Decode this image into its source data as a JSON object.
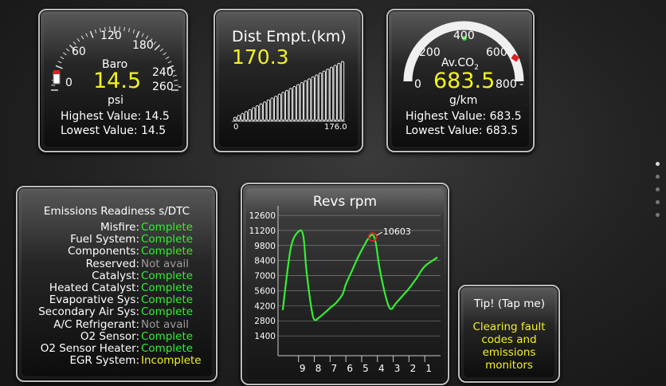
{
  "baro": {
    "title": "Baro",
    "value": "14.5",
    "unit": "psi",
    "ticks": [
      "0",
      "60",
      "120",
      "180",
      "240",
      "260"
    ],
    "highest": "Highest Value: 14.5",
    "lowest": "Lowest Value: 14.5"
  },
  "dist": {
    "title": "Dist Empt.(km)",
    "value": "170.3",
    "x_min": "0",
    "x_max": "176.0"
  },
  "co2": {
    "title": "Av.CO",
    "title_sub": "2",
    "value": "683.5",
    "unit": "g/km",
    "ticks": [
      "0",
      "200",
      "400",
      "600",
      "800"
    ],
    "highest": "Highest Value: 683.5",
    "lowest": "Lowest Value: 683.5",
    "colors": {
      "arc": "#f0f0f0",
      "marker": "#33dd33",
      "warn": "#e02020"
    }
  },
  "emissions": {
    "title": "Emissions Readiness s/DTC",
    "rows": [
      {
        "label": "Misfire:",
        "status": "Complete",
        "state": "complete"
      },
      {
        "label": "Fuel System:",
        "status": "Complete",
        "state": "complete"
      },
      {
        "label": "Components:",
        "status": "Complete",
        "state": "complete"
      },
      {
        "label": "Reserved:",
        "status": "Not avail",
        "state": "na"
      },
      {
        "label": "Catalyst:",
        "status": "Complete",
        "state": "complete"
      },
      {
        "label": "Heated Catalyst:",
        "status": "Complete",
        "state": "complete"
      },
      {
        "label": "Evaporative Sys:",
        "status": "Complete",
        "state": "complete"
      },
      {
        "label": "Secondary Air Sys:",
        "status": "Complete",
        "state": "complete"
      },
      {
        "label": "A/C Refrigerant:",
        "status": "Not avail",
        "state": "na"
      },
      {
        "label": "O2 Sensor:",
        "status": "Complete",
        "state": "complete"
      },
      {
        "label": "O2 Sensor Heater:",
        "status": "Complete",
        "state": "complete"
      },
      {
        "label": "EGR System:",
        "status": "Incomplete",
        "state": "incomplete"
      }
    ],
    "colors": {
      "complete": "#33ee33",
      "na": "#9c9c9c",
      "incomplete": "#f2f222"
    }
  },
  "revs": {
    "title": "Revs rpm",
    "peak_label": "10603",
    "line_color": "#33ee33"
  },
  "tip": {
    "title": "Tip! (Tap me)",
    "text": "Clearing fault codes and emissions monitors"
  },
  "chart_data": {
    "type": "line",
    "title": "Revs rpm",
    "xlabel": "",
    "ylabel": "",
    "x": [
      10,
      9.5,
      9,
      8.7,
      8.5,
      8.2,
      8,
      7.7,
      7.3,
      7,
      6.6,
      6.2,
      6,
      5.6,
      5.2,
      4.8,
      4.6,
      4.3,
      4.1,
      3.9,
      3.6,
      3.3,
      3.1,
      2.9,
      2.6,
      2.3,
      2.0,
      1.7,
      1.5,
      1.2,
      0.9,
      0.5,
      0.2
    ],
    "y": [
      3800,
      9500,
      11100,
      10700,
      7500,
      4100,
      2900,
      3100,
      3600,
      4000,
      4500,
      5300,
      6200,
      7500,
      8800,
      9900,
      10400,
      10800,
      10000,
      8000,
      5800,
      4200,
      3900,
      4300,
      4800,
      5300,
      5800,
      6400,
      6800,
      7500,
      8000,
      8400,
      8700
    ],
    "x_ticks": [
      "9",
      "8",
      "7",
      "6",
      "5",
      "4",
      "3",
      "2",
      "1"
    ],
    "y_ticks": [
      "12600",
      "11200",
      "9800",
      "8400",
      "7000",
      "5600",
      "4200",
      "2800",
      "1400"
    ],
    "xlim": [
      10.3,
      0
    ],
    "ylim": [
      0,
      13200
    ],
    "annotations": [
      {
        "x": 4.3,
        "y": 10603,
        "text": "10603"
      }
    ],
    "grid": true,
    "legend": "none"
  }
}
